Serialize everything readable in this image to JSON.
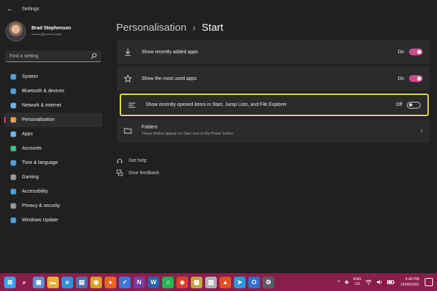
{
  "window": {
    "title": "Settings",
    "back_glyph": "←"
  },
  "profile": {
    "name": "Brad Stephenson",
    "email": "••••••••@••••••••.com"
  },
  "search": {
    "placeholder": "Find a setting",
    "icon": "search-icon"
  },
  "sidebar": {
    "items": [
      {
        "label": "System",
        "icon": "system-icon",
        "color": "#4aa3e0",
        "selected": false
      },
      {
        "label": "Bluetooth & devices",
        "icon": "bluetooth-icon",
        "color": "#4aa3e0",
        "selected": false
      },
      {
        "label": "Network & internet",
        "icon": "network-icon",
        "color": "#6bb5e8",
        "selected": false
      },
      {
        "label": "Personalisation",
        "icon": "paintbrush-icon",
        "color": "#e8a050",
        "selected": true
      },
      {
        "label": "Apps",
        "icon": "apps-icon",
        "color": "#6bb5e8",
        "selected": false
      },
      {
        "label": "Accounts",
        "icon": "accounts-icon",
        "color": "#3fbf8a",
        "selected": false
      },
      {
        "label": "Time & language",
        "icon": "globe-icon",
        "color": "#4aa3e0",
        "selected": false
      },
      {
        "label": "Gaming",
        "icon": "gaming-icon",
        "color": "#9a9a9a",
        "selected": false
      },
      {
        "label": "Accessibility",
        "icon": "accessibility-icon",
        "color": "#4aa3e0",
        "selected": false
      },
      {
        "label": "Privacy & security",
        "icon": "shield-icon",
        "color": "#9a9a9a",
        "selected": false
      },
      {
        "label": "Windows Update",
        "icon": "update-icon",
        "color": "#4aa3e0",
        "selected": false
      }
    ]
  },
  "breadcrumb": {
    "parent": "Personalisation",
    "separator": "›",
    "current": "Start"
  },
  "settings": {
    "recently_added": {
      "label": "Show recently added apps",
      "state": "On",
      "icon": "download-icon"
    },
    "most_used": {
      "label": "Show the most used apps",
      "state": "On",
      "icon": "star-icon"
    },
    "recently_opened": {
      "label": "Show recently opened items in Start, Jump Lists, and File Explorer",
      "state": "Off",
      "icon": "list-icon"
    },
    "folders": {
      "title": "Folders",
      "subtitle": "These folders appear on Start next to the Power button",
      "icon": "folder-icon",
      "chevron": "›"
    }
  },
  "links": {
    "help": {
      "label": "Get help",
      "icon": "help-icon"
    },
    "feedback": {
      "label": "Give feedback",
      "icon": "feedback-icon"
    }
  },
  "taskbar": {
    "apps": [
      {
        "name": "start-icon",
        "glyph": "⊞",
        "color": "#3aa0e8"
      },
      {
        "name": "search-icon",
        "glyph": "⌕",
        "color": "#8a1e4a"
      },
      {
        "name": "task-view-icon",
        "glyph": "▣",
        "color": "#5a8fd0"
      },
      {
        "name": "file-explorer-icon",
        "glyph": "▬",
        "color": "#e8b030"
      },
      {
        "name": "edge-icon",
        "glyph": "e",
        "color": "#2f8fd8"
      },
      {
        "name": "notepad-icon",
        "glyph": "▤",
        "color": "#4f6fa8"
      },
      {
        "name": "chrome-icon",
        "glyph": "◉",
        "color": "#dca020"
      },
      {
        "name": "firefox-icon",
        "glyph": "●",
        "color": "#e8652a"
      },
      {
        "name": "todo-icon",
        "glyph": "✓",
        "color": "#3a78d8"
      },
      {
        "name": "onenote-icon",
        "glyph": "N",
        "color": "#7a3aa8"
      },
      {
        "name": "word-icon",
        "glyph": "W",
        "color": "#2b5fb0"
      },
      {
        "name": "spotify-icon",
        "glyph": "♫",
        "color": "#1db954"
      },
      {
        "name": "paint-icon",
        "glyph": "◆",
        "color": "#d8402a"
      },
      {
        "name": "backup-icon",
        "glyph": "▦",
        "color": "#c8a040"
      },
      {
        "name": "photos-icon",
        "glyph": "▧",
        "color": "#b0b0b0"
      },
      {
        "name": "brave-icon",
        "glyph": "▲",
        "color": "#e05020"
      },
      {
        "name": "telegram-icon",
        "glyph": "➤",
        "color": "#2a9ad8"
      },
      {
        "name": "outlook-icon",
        "glyph": "O",
        "color": "#2f70c8"
      },
      {
        "name": "settings-icon",
        "glyph": "⚙",
        "color": "#5a5a6a"
      }
    ],
    "tray": {
      "chevron": "^",
      "lang_top": "ENG",
      "lang_bottom": "US",
      "time": "4:28 PM",
      "date": "12/08/2021"
    }
  }
}
